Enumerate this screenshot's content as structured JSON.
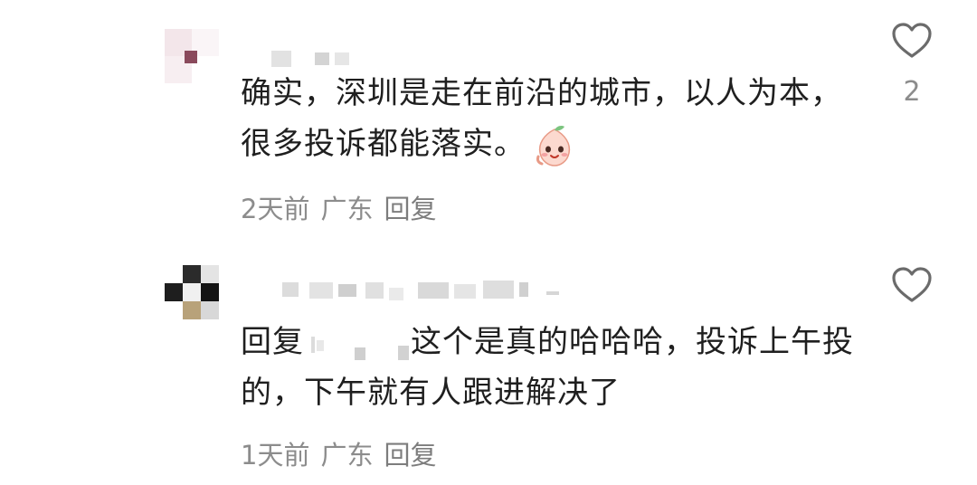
{
  "comments": [
    {
      "text": "确实，深圳是走在前沿的城市，以人为本，很多投诉都能落实。",
      "emoji": "smiling-peach-emoji",
      "time": "2天前",
      "location": "广东",
      "reply_label": "回复",
      "likes": "2"
    },
    {
      "reply_prefix": "回复",
      "text": "这个是真的哈哈哈，投诉上午投的，下午就有人跟进解决了",
      "time": "1天前",
      "location": "广东",
      "reply_label": "回复",
      "likes": ""
    }
  ],
  "icons": {
    "like": "heart-outline-icon"
  },
  "colors": {
    "text": "#1f1f1f",
    "meta": "#8c8c8c",
    "icon": "#6b6b6b"
  }
}
